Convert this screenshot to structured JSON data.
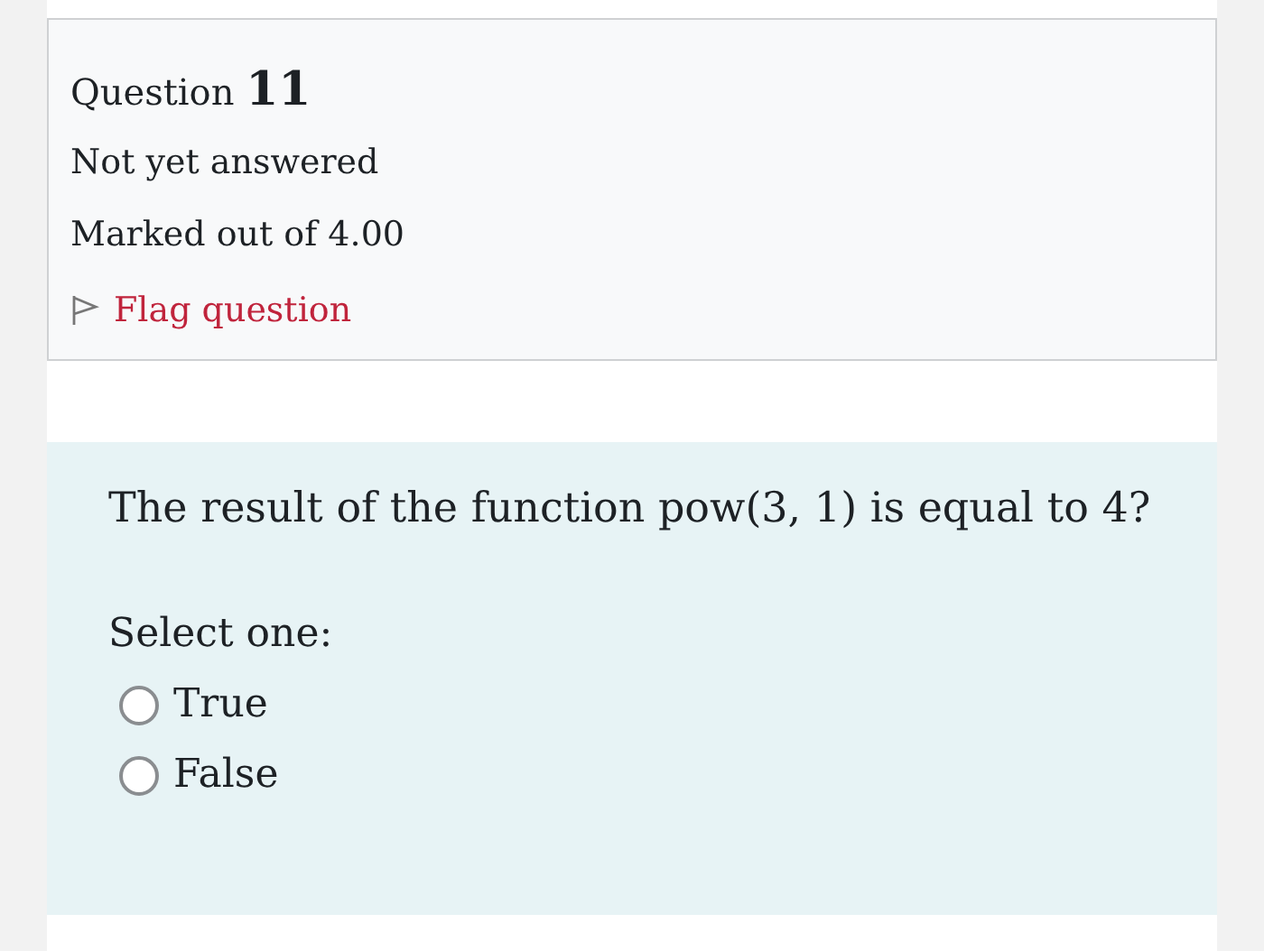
{
  "info": {
    "title": "Question **11**",
    "state": "Not yet answered",
    "grade": "Marked out of 4.00",
    "flag": {
      "label": "Flag question",
      "flagged": false
    }
  },
  "question": {
    "text": "The result of the function pow(3, 1) is equal to 4?",
    "prompt": "Select one:",
    "options": [
      {
        "label": "True",
        "selected": false
      },
      {
        "label": "False",
        "selected": false
      }
    ]
  }
}
